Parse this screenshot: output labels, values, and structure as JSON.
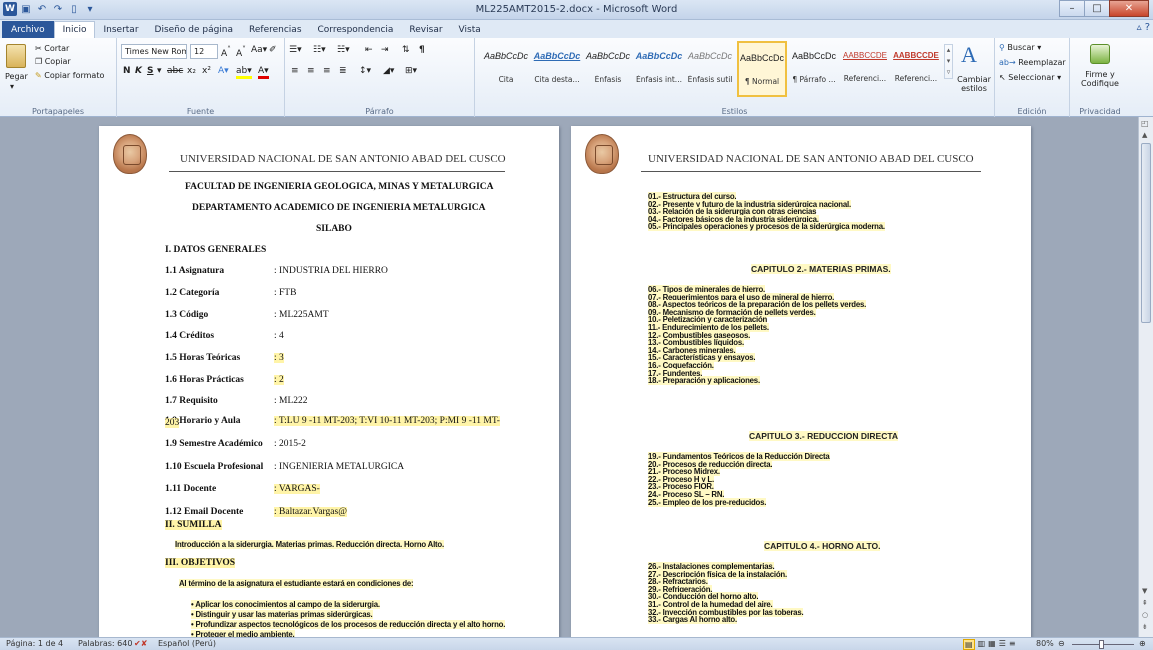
{
  "window": {
    "title": "ML225AMT2015-2.docx - Microsoft Word",
    "controls": [
      "–",
      "□",
      "✕"
    ]
  },
  "tabs": [
    "Archivo",
    "Inicio",
    "Insertar",
    "Diseño de página",
    "Referencias",
    "Correspondencia",
    "Revisar",
    "Vista"
  ],
  "active_tab": "Inicio",
  "ribbon": {
    "clipboard": {
      "label": "Portapapeles",
      "paste": "Pegar",
      "cut": "Cortar",
      "copy": "Copiar",
      "format_painter": "Copiar formato"
    },
    "font": {
      "label": "Fuente",
      "font_name": "Times New Rom",
      "font_size": "12"
    },
    "paragraph": {
      "label": "Párrafo"
    },
    "styles": {
      "label": "Estilos",
      "items": [
        {
          "preview": "AaBbCcDc",
          "name": "Cita"
        },
        {
          "preview": "AaBbCcDc",
          "name": "Cita desta..."
        },
        {
          "preview": "AaBbCcDc",
          "name": "Énfasis"
        },
        {
          "preview": "AaBbCcDc",
          "name": "Énfasis int..."
        },
        {
          "preview": "AaBbCcDc",
          "name": "Énfasis sutil"
        },
        {
          "preview": "AaBbCcDc",
          "name": "¶ Normal"
        },
        {
          "preview": "AaBbCcDc",
          "name": "¶ Párrafo ..."
        },
        {
          "preview": "AABBCCDE",
          "name": "Referenci..."
        },
        {
          "preview": "AABBCCDE",
          "name": "Referenci..."
        }
      ],
      "change": "Cambiar estilos"
    },
    "editing": {
      "label": "Edición",
      "find": "Buscar",
      "replace": "Reemplazar",
      "select": "Seleccionar"
    },
    "privacy": {
      "label": "Privacidad",
      "sign": "Firme y Codifique"
    }
  },
  "page1": {
    "university": "UNIVERSIDAD NACIONAL DE SAN ANTONIO ABAD DEL CUSCO",
    "faculty": "FACULTAD DE INGENIERIA GEOLOGICA, MINAS Y METALURGICA",
    "department": "DEPARTAMENTO ACADEMICO DE INGENIERIA METALURGICA",
    "doc_title": "SILABO",
    "section1": "I. DATOS GENERALES",
    "fields": [
      {
        "label": "1.1  Asignatura",
        "value": ": INDUSTRIA DEL HIERRO"
      },
      {
        "label": "1.2  Categoría",
        "value": ": FTB"
      },
      {
        "label": "1.3  Código",
        "value": ": ML225AMT"
      },
      {
        "label": "1.4  Créditos",
        "value": ": 4"
      },
      {
        "label": "1.5  Horas Teóricas",
        "value": ": 3"
      },
      {
        "label": "1.6  Horas Prácticas",
        "value": ": 2"
      },
      {
        "label": "1.7  Requisito",
        "value": ": ML222"
      },
      {
        "label": "1.8  Horario y Aula",
        "value": ": T:LU 9 -11 MT-203;  T:VI 10-11 MT-203;  P:MI 9 -11 MT-"
      },
      {
        "label": "1.9  Semestre Académico",
        "value": ": 2015-2"
      },
      {
        "label": "1.10 Escuela Profesional",
        "value": ": INGENIERIA METALURGICA"
      },
      {
        "label": "1.11 Docente",
        "value": ": VARGAS-"
      },
      {
        "label": "1.12 Email Docente",
        "value": ": Baltazar.Vargas@"
      }
    ],
    "horario_cont": "203",
    "section2": "II.  SUMILLA",
    "sumilla": "Introducción a la siderurgia.  Materias primas.  Reducción directa. Horno Alto.",
    "section3": "III.  OBJETIVOS",
    "objetivos_intro": "Al término de la asignatura el estudiante estará en condiciones de:",
    "objetivos": [
      "Aplicar los conocimientos al campo de la siderurgia.",
      "Distinguir y usar las materias primas siderúrgicas.",
      "Profundizar aspectos tecnológicos de los procesos de reducción directa  y  el alto horno.",
      "Proteger el medio ambiente."
    ]
  },
  "page2": {
    "university": "UNIVERSIDAD NACIONAL DE SAN ANTONIO ABAD DEL CUSCO",
    "list1": [
      "01.-  Estructura del curso.",
      "02.-  Presente y futuro de la industria siderúrgica nacional.",
      "03.-  Relación de la siderurgia con otras ciencias",
      "04.-  Factores básicos de la  industria siderúrgica.",
      "05.-  Principales operaciones y procesos de la siderúrgica moderna."
    ],
    "chap2": "CAPITULO  2.-  MATERIAS  PRIMAS.",
    "list2": [
      "06.-  Tipos de minerales de hierro.",
      "07.-  Requerimientos para el uso de mineral de hierro.",
      "08.-  Aspectos teóricos de la preparación de los pellets verdes.",
      "09.-  Mecanismo de formación de pellets verdes.",
      "10.-  Peletización y caracterización",
      "11.-  Endurecimiento de los pellets.",
      "12.-  Combustibles gaseosos.",
      "13.-  Combustibles líquidos.",
      "14.-  Carbones minerales.",
      "15.-  Características y ensayos.",
      "16.-  Coquefacción.",
      "17.-  Fundentes.",
      "18.-  Preparación y aplicaciones."
    ],
    "chap3": "CAPITULO  3.-  REDUCCION  DIRECTA",
    "list3": [
      "19.-  Fundamentos Teóricos de la Reducción Directa",
      "20.-  Procesos de reducción directa.",
      "21.-  Proceso Midrex.",
      "22.-  Proceso H y L.",
      "23.-  Proceso FIOR.",
      "24.-  Proceso SL – RN.",
      "25.-  Empleo de los pre-reducidos."
    ],
    "chap4": "CAPITULO  4.-  HORNO  ALTO.",
    "list4": [
      "26.-  Instalaciones complementarias.",
      "27.-  Descripción física de la instalación.",
      "28.-  Refractarios.",
      "29.-  Refrigeración.",
      "30.-  Conducción del horno alto.",
      "31.-  Control de la humedad del aire.",
      "32.-  Inyección combustibles por las toberas.",
      "33.-  Cargas Al horno alto."
    ]
  },
  "status": {
    "page": "Página: 1 de 4",
    "words": "Palabras: 640",
    "language": "Español (Perú)",
    "zoom": "80%"
  }
}
